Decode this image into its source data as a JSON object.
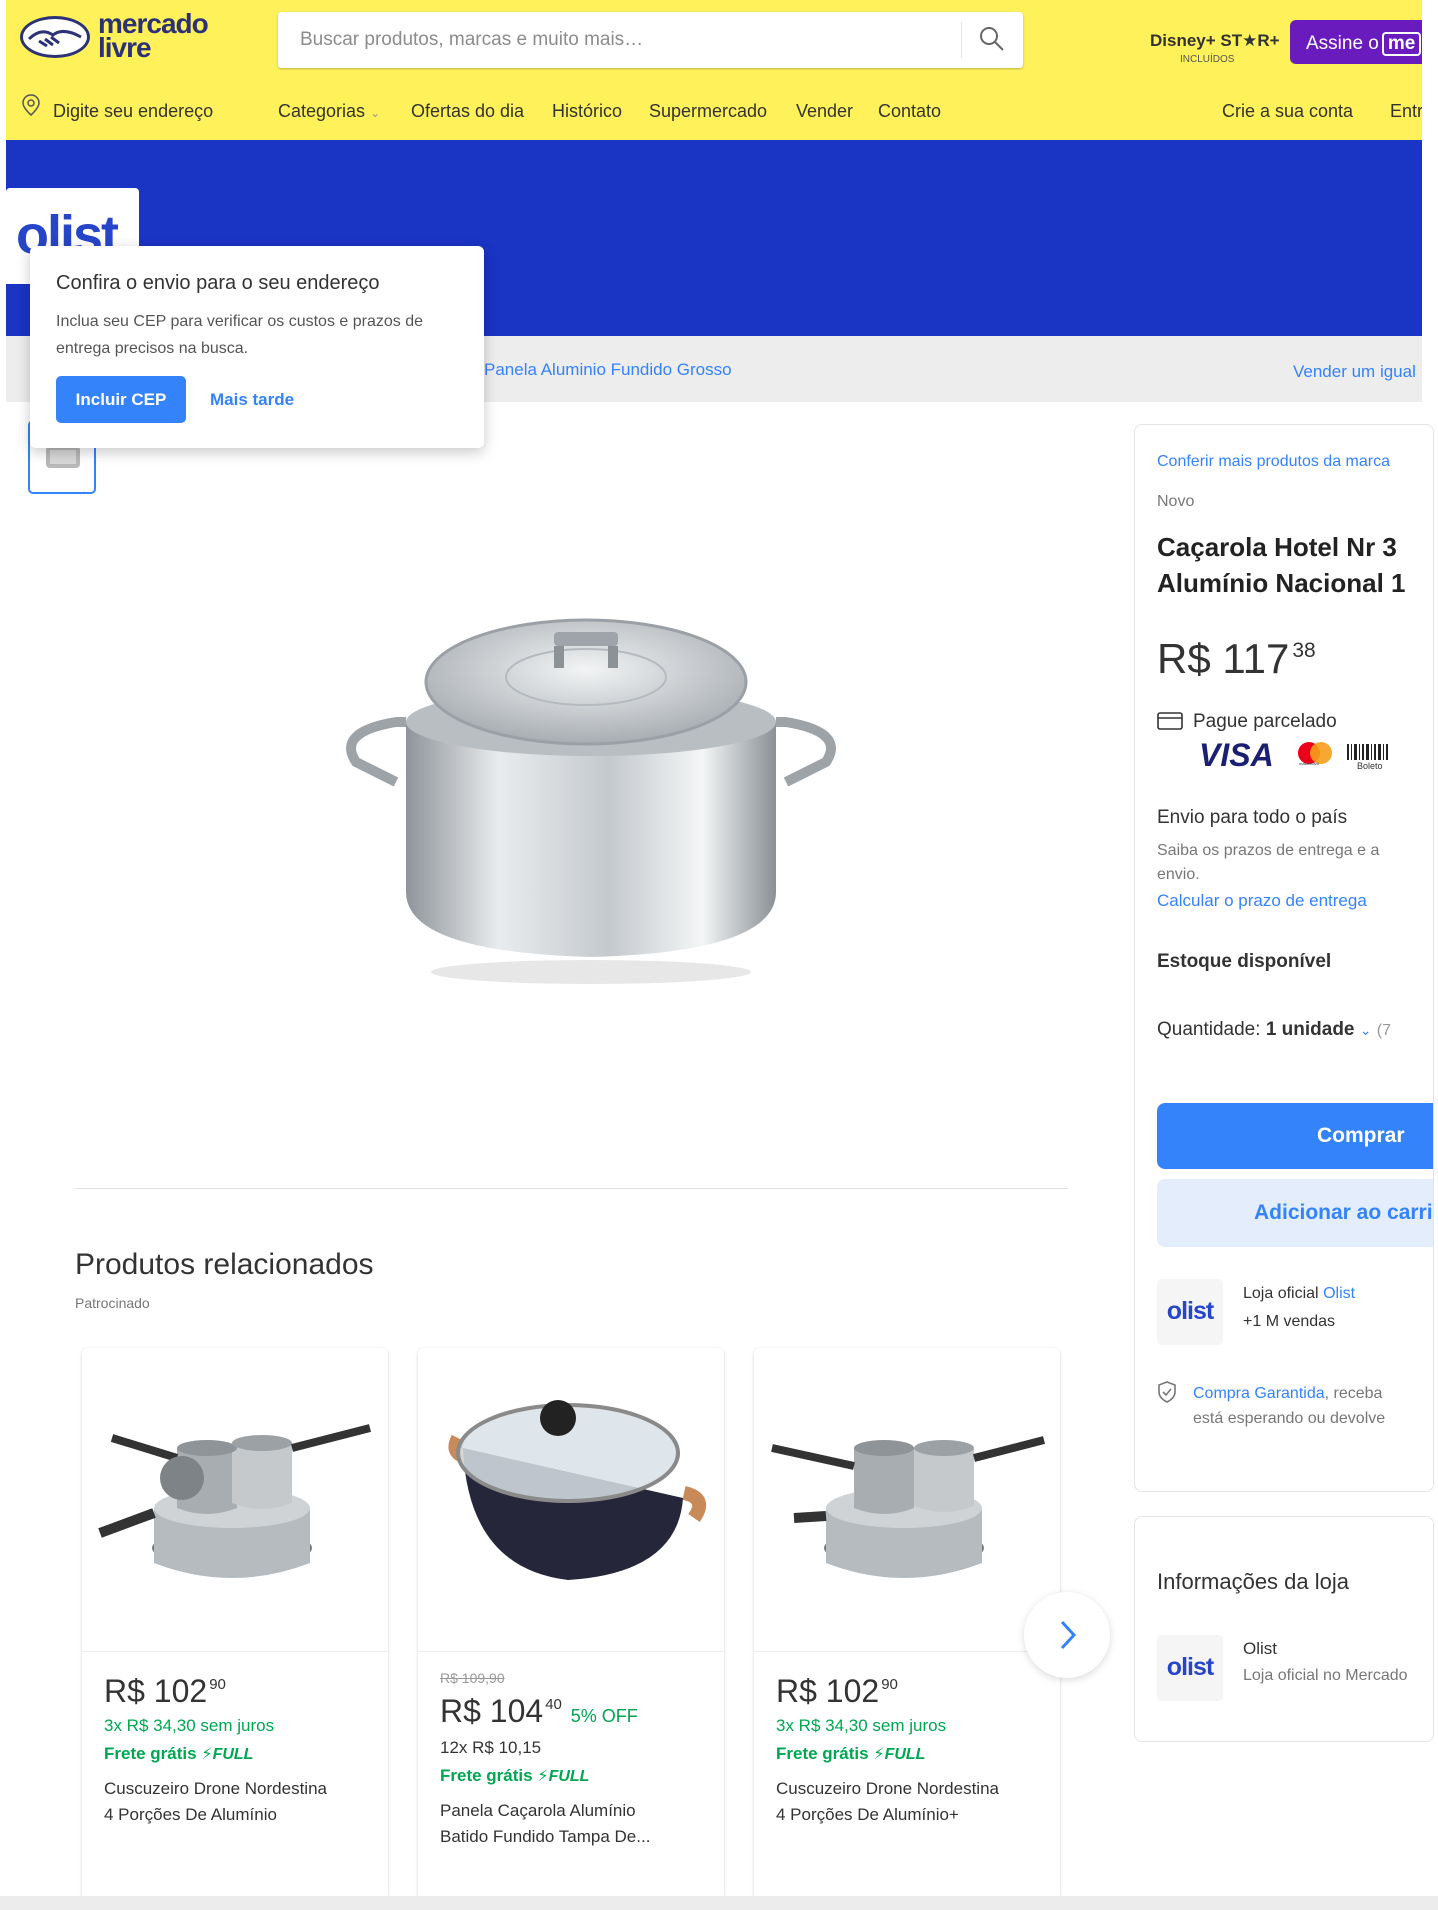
{
  "header": {
    "logo_line1": "mercado",
    "logo_line2": "livre",
    "search_placeholder": "Buscar produtos, marcas e muito mais…",
    "disney_label": "Disney+ ST★R+",
    "disney_sub": "INCLUÍDOS",
    "assine_label": "Assine o",
    "assine_badge": "me"
  },
  "nav": {
    "address": "Digite seu endereço",
    "items": [
      "Categorias",
      "Ofertas do dia",
      "Histórico",
      "Supermercado",
      "Vender",
      "Contato"
    ],
    "create_account": "Crie a sua conta",
    "enter": "Entre"
  },
  "store_logo": "olist",
  "breadcrumb": "Panela Aluminio Fundido Grosso",
  "sell_similar": "Vender um igual",
  "popup": {
    "title": "Confira o envio para o seu endereço",
    "body": "Inclua seu CEP para verificar os custos e prazos de entrega precisos na busca.",
    "primary": "Incluir CEP",
    "secondary": "Mais tarde"
  },
  "buybox": {
    "brand_link": "Conferir mais produtos da marca",
    "condition": "Novo",
    "title_line1": "Caçarola Hotel Nr 3",
    "title_line2": "Alumínio Nacional 1",
    "price_int": "R$ 117",
    "price_cents": "38",
    "installments": "Pague parcelado",
    "visa": "VISA",
    "mastercard": "mastercard",
    "boleto": "Boleto",
    "shipping_title": "Envio para todo o país",
    "shipping_desc1": "Saiba os prazos de entrega e a",
    "shipping_desc2": "envio.",
    "shipping_link": "Calcular o prazo de entrega",
    "stock": "Estoque disponível",
    "qty_label": "Quantidade:",
    "qty_value": "1 unidade",
    "qty_avail": "(7",
    "buy": "Comprar",
    "add_cart": "Adicionar ao carrinho",
    "seller_prefix": "Loja oficial",
    "seller_name": "Olist",
    "seller_sales": "+1 M vendas",
    "guarantee_link": "Compra Garantida",
    "guarantee_rest1": ", receba",
    "guarantee_rest2": "está esperando ou devolve"
  },
  "store_info": {
    "title": "Informações da loja",
    "name": "Olist",
    "desc": "Loja oficial no Mercado"
  },
  "related": {
    "title": "Produtos relacionados",
    "sponsored": "Patrocinado",
    "products": [
      {
        "old_price": "",
        "price_int": "R$ 102",
        "price_cents": "90",
        "discount": "",
        "installments": "3x R$ 34,30 sem juros",
        "shipping": "Frete grátis",
        "full": "FULL",
        "name_line1": "Cuscuzeiro Drone Nordestina",
        "name_line2": "4 Porções De Alumínio"
      },
      {
        "old_price": "R$ 109,90",
        "price_int": "R$ 104",
        "price_cents": "40",
        "discount": "5% OFF",
        "installments": "12x R$ 10,15",
        "shipping": "Frete grátis",
        "full": "FULL",
        "name_line1": "Panela Caçarola Alumínio",
        "name_line2": "Batido Fundido Tampa De..."
      },
      {
        "old_price": "",
        "price_int": "R$ 102",
        "price_cents": "90",
        "discount": "",
        "installments": "3x R$ 34,30 sem juros",
        "shipping": "Frete grátis",
        "full": "FULL",
        "name_line1": "Cuscuzeiro Drone Nordestina",
        "name_line2": "4 Porções De Alumínio+"
      }
    ]
  },
  "colors": {
    "header_yellow": "#fff159",
    "banner_blue": "#1a34c4",
    "link_blue": "#3483fa",
    "green": "#00a650",
    "purple": "#6a1bbd"
  }
}
